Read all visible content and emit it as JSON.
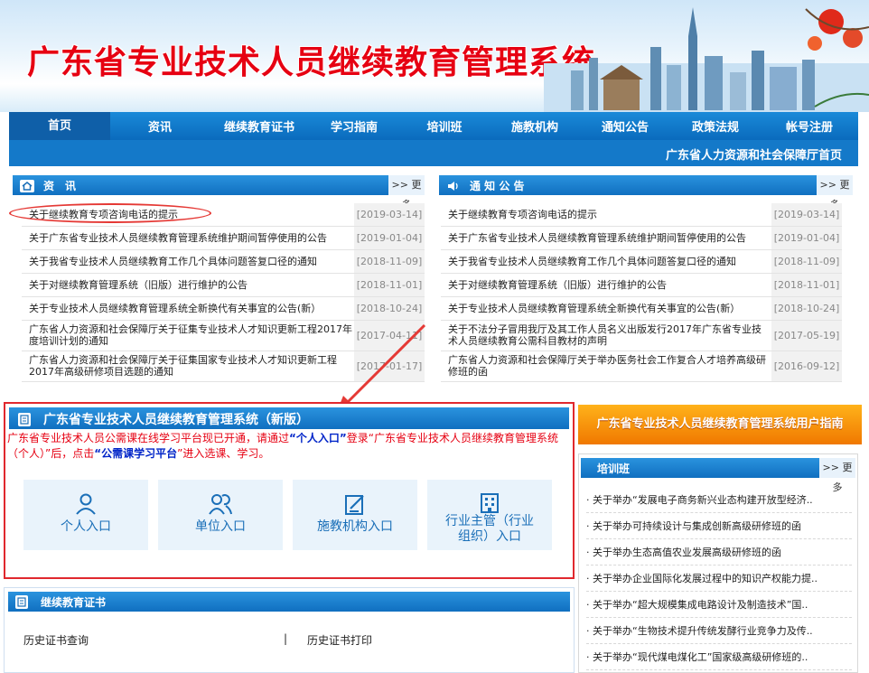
{
  "banner": {
    "title": "广东省专业技术人员继续教育管理系统"
  },
  "nav": {
    "items": [
      "首页",
      "资讯",
      "继续教育证书",
      "学习指南",
      "培训班",
      "施教机构",
      "通知公告",
      "政策法规",
      "帐号注册"
    ],
    "sublink": "广东省人力资源和社会保障厅首页"
  },
  "news": {
    "title": "资　讯",
    "more": ">> 更多",
    "items": [
      {
        "title": "关于继续教育专项咨询电话的提示",
        "date": "[2019-03-14]"
      },
      {
        "title": "关于广东省专业技术人员继续教育管理系统维护期间暂停使用的公告",
        "date": "[2019-01-04]"
      },
      {
        "title": "关于我省专业技术人员继续教育工作几个具体问题答复口径的通知",
        "date": "[2018-11-09]"
      },
      {
        "title": "关于对继续教育管理系统（旧版）进行维护的公告",
        "date": "[2018-11-01]"
      },
      {
        "title": "关于专业技术人员继续教育管理系统全新换代有关事宜的公告(新）",
        "date": "[2018-10-24]"
      },
      {
        "title": "广东省人力资源和社会保障厅关于征集专业技术人才知识更新工程2017年度培训计划的通知",
        "date": "[2017-04-11]"
      },
      {
        "title": "广东省人力资源和社会保障厅关于征集国家专业技术人才知识更新工程2017年高级研修项目选题的通知",
        "date": "[2017-01-17]"
      }
    ]
  },
  "notices": {
    "title": "通 知 公 告",
    "more": ">> 更多",
    "items": [
      {
        "title": "关于继续教育专项咨询电话的提示",
        "date": "[2019-03-14]"
      },
      {
        "title": "关于广东省专业技术人员继续教育管理系统维护期间暂停使用的公告",
        "date": "[2019-01-04]"
      },
      {
        "title": "关于我省专业技术人员继续教育工作几个具体问题答复口径的通知",
        "date": "[2018-11-09]"
      },
      {
        "title": "关于对继续教育管理系统（旧版）进行维护的公告",
        "date": "[2018-11-01]"
      },
      {
        "title": "关于专业技术人员继续教育管理系统全新换代有关事宜的公告(新）",
        "date": "[2018-10-24]"
      },
      {
        "title": "关于不法分子冒用我厅及其工作人员名义出版发行2017年广东省专业技术人员继续教育公需科目教材的声明",
        "date": "[2017-05-19]"
      },
      {
        "title": "广东省人力资源和社会保障厅关于举办医务社会工作复合人才培养高级研修班的函",
        "date": "[2016-09-12]"
      }
    ]
  },
  "newsys": {
    "title": "广东省专业技术人员继续教育管理系统（新版）",
    "notice_1": "广东省专业技术人员公需课在线学习平台现已开通，请通过",
    "notice_q1": "“个人入口”",
    "notice_2": "登录“广东省专业技术人员继续教育管理系统（个人）”后，点击",
    "notice_q2": "“公需课学习平台",
    "notice_3": "”进入选课、学习。",
    "portals": {
      "personal": "个人入口",
      "unit": "单位入口",
      "institution": "施教机构入口",
      "admin_1": "行业主管（行业",
      "admin_2": "组织）入口"
    }
  },
  "guide": {
    "label": "广东省专业技术人员继续教育管理系统用户指南"
  },
  "training": {
    "title": "培训班",
    "more": ">> 更多",
    "items": [
      "· 关于举办“发展电子商务新兴业态构建开放型经济..",
      "· 关于举办可持续设计与集成创新高级研修班的函",
      "· 关于举办生态高值农业发展高级研修班的函",
      "· 关于举办企业国际化发展过程中的知识产权能力提..",
      "· 关于举办“超大规模集成电路设计及制造技术”国..",
      "· 关于举办“生物技术提升传统发酵行业竞争力及传..",
      "· 关于举办“现代煤电煤化工”国家级高级研修班的.."
    ]
  },
  "cert": {
    "title": "继续教育证书",
    "query": "历史证书查询",
    "sep": "|",
    "print": "历史证书打印"
  }
}
